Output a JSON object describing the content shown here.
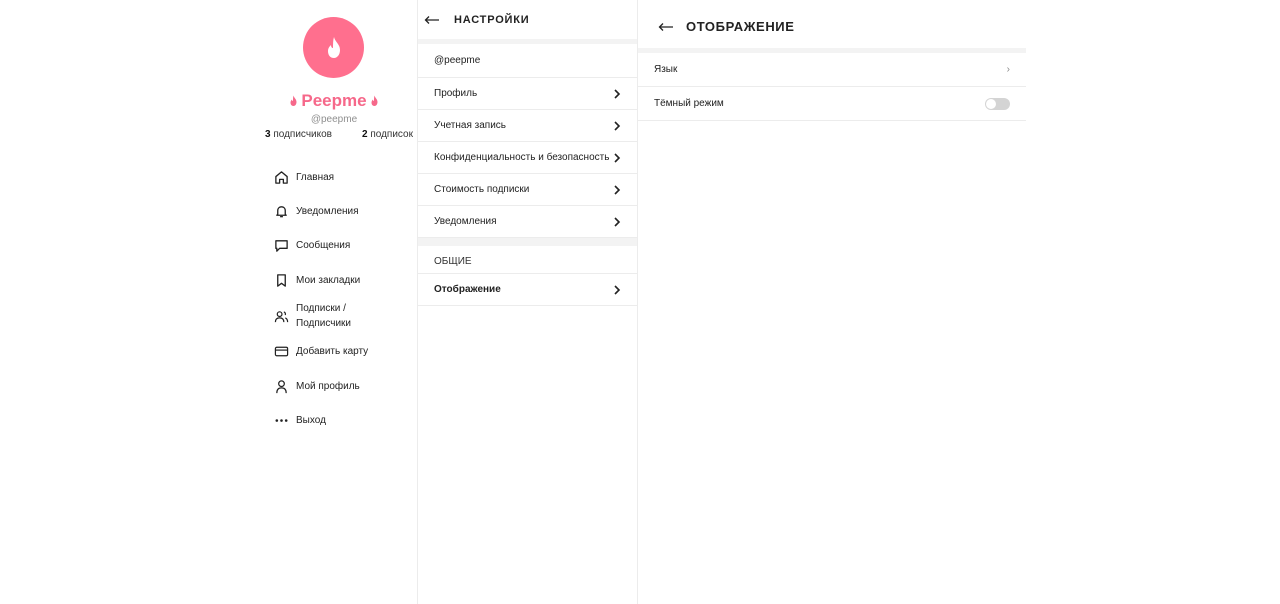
{
  "profile": {
    "brand_name": "Peepme",
    "handle": "@peepme",
    "followers_count": "3",
    "followers_label": "подписчиков",
    "following_count": "2",
    "following_label": "подписок"
  },
  "sidebar": {
    "items": [
      {
        "label": "Главная",
        "icon": "home-icon"
      },
      {
        "label": "Уведомления",
        "icon": "bell-icon"
      },
      {
        "label": "Сообщения",
        "icon": "message-icon"
      },
      {
        "label": "Мои закладки",
        "icon": "bookmark-icon"
      },
      {
        "label": "Подписки /\nПодписчики",
        "icon": "users-icon"
      },
      {
        "label": "Добавить карту",
        "icon": "card-icon"
      },
      {
        "label": "Мой профиль",
        "icon": "user-icon"
      },
      {
        "label": "Выход",
        "icon": "more-icon"
      }
    ]
  },
  "settings": {
    "title": "НАСТРОЙКИ",
    "handle": "@peepme",
    "items": [
      {
        "label": "Профиль"
      },
      {
        "label": "Учетная запись"
      },
      {
        "label": "Конфиденциальность и безопасность"
      },
      {
        "label": "Стоимость подписки"
      },
      {
        "label": "Уведомления"
      }
    ],
    "general_label": "ОБЩИЕ",
    "general_items": [
      {
        "label": "Отображение"
      }
    ]
  },
  "display": {
    "title": "ОТОБРАЖЕНИЕ",
    "language_label": "Язык",
    "dark_mode_label": "Тёмный режим",
    "dark_mode_on": false
  },
  "colors": {
    "brand": "#f6688a",
    "avatar_bg": "#ff6f8e",
    "toggle_off": "#d4d4d4"
  }
}
